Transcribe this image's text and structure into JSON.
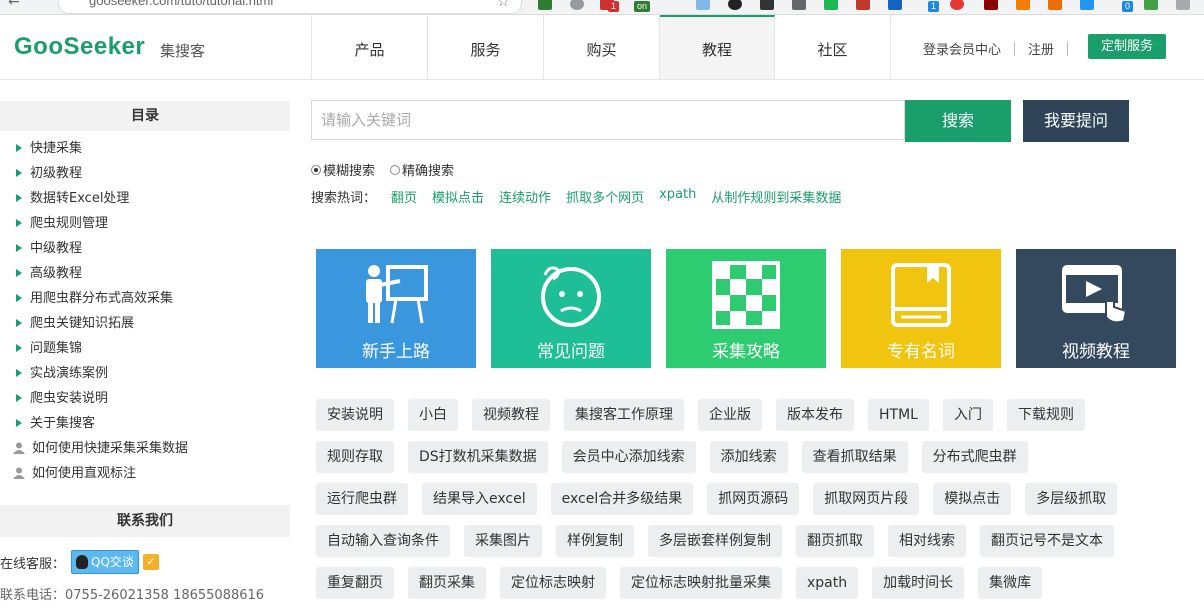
{
  "browser": {
    "url": "gooseeker.com/tuto/tutorial.html",
    "extension_badges": [
      "1",
      "on",
      "1",
      "0"
    ]
  },
  "header": {
    "logo_text": "GooSeeker",
    "logo_sub": "集搜客",
    "nav": [
      "产品",
      "服务",
      "购买",
      "教程",
      "社区"
    ],
    "login": "登录会员中心",
    "register": "注册",
    "custom_service": "定制服务"
  },
  "sidebar": {
    "title": "目录",
    "items": [
      "快捷采集",
      "初级教程",
      "数据转Excel处理",
      "爬虫规则管理",
      "中级教程",
      "高级教程",
      "用爬虫群分布式高效采集",
      "爬虫关键知识拓展",
      "问题集锦",
      "实战演练案例",
      "爬虫安装说明",
      "关于集搜客"
    ],
    "user_items": [
      "如何使用快捷采集采集数据",
      "如何使用直观标注"
    ],
    "contact_title": "联系我们",
    "online_label": "在线客服：",
    "qq_label": "QQ交谈",
    "phone_text": "联系电话：0755-26021358 18655088616"
  },
  "search": {
    "placeholder": "请输入关键词",
    "search_button": "搜索",
    "ask_button": "我要提问",
    "fuzzy": "模糊搜索",
    "exact": "精确搜索",
    "selected_mode": "模糊搜索",
    "hot_label": "搜索热词：",
    "hot_words": [
      "翻页",
      "模拟点击",
      "连续动作",
      "抓取多个网页",
      "xpath",
      "从制作规则到采集数据"
    ]
  },
  "cards": [
    {
      "label": "新手上路",
      "color": "#3a97dd",
      "icon": "teacher-board-icon"
    },
    {
      "label": "常见问题",
      "color": "#1ebf96",
      "icon": "confused-face-icon"
    },
    {
      "label": "采集攻略",
      "color": "#2ecc71",
      "icon": "chessboard-icon"
    },
    {
      "label": "专有名词",
      "color": "#f1c40f",
      "icon": "book-icon"
    },
    {
      "label": "视频教程",
      "color": "#34495e",
      "icon": "video-player-icon"
    }
  ],
  "tags": [
    [
      "安装说明",
      "小白",
      "视频教程",
      "集搜客工作原理",
      "企业版",
      "版本发布",
      "HTML",
      "入门",
      "下载规则"
    ],
    [
      "规则存取",
      "DS打数机采集数据",
      "会员中心添加线索",
      "添加线索",
      "查看抓取结果",
      "分布式爬虫群"
    ],
    [
      "运行爬虫群",
      "结果导入excel",
      "excel合并多级结果",
      "抓网页源码",
      "抓取网页片段",
      "模拟点击",
      "多层级抓取"
    ],
    [
      "自动输入查询条件",
      "采集图片",
      "样例复制",
      "多层嵌套样例复制",
      "翻页抓取",
      "相对线索",
      "翻页记号不是文本"
    ],
    [
      "重复翻页",
      "翻页采集",
      "定位标志映射",
      "定位标志映射批量采集",
      "xpath",
      "加载时间长",
      "集微库"
    ]
  ]
}
